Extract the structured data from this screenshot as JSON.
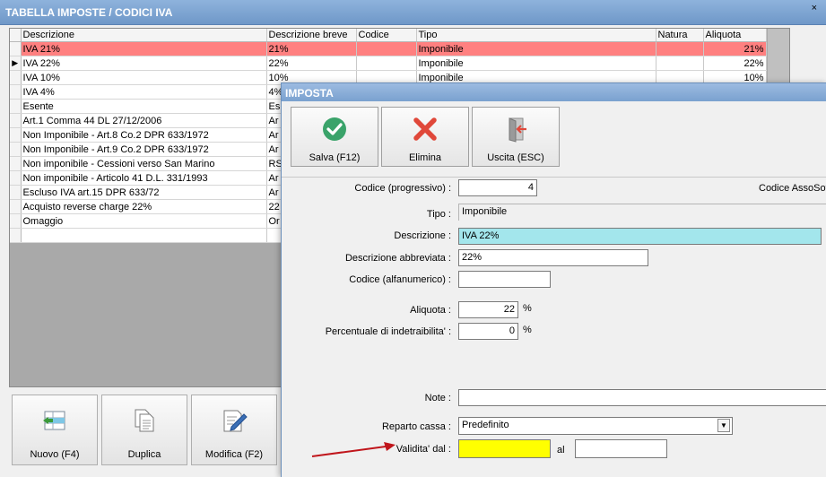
{
  "main_window": {
    "title": "TABELLA IMPOSTE / CODICI IVA",
    "close_glyph": "×",
    "table": {
      "columns": [
        "Descrizione",
        "Descrizione breve",
        "Codice",
        "Tipo",
        "Natura",
        "Aliquota"
      ],
      "rows": [
        {
          "descrizione": "IVA 21%",
          "breve": "21%",
          "codice": "",
          "tipo": "Imponibile",
          "natura": "",
          "aliquota": "21%"
        },
        {
          "descrizione": "IVA 22%",
          "breve": "22%",
          "codice": "",
          "tipo": "Imponibile",
          "natura": "",
          "aliquota": "22%"
        },
        {
          "descrizione": "IVA 10%",
          "breve": "10%",
          "codice": "",
          "tipo": "Imponibile",
          "natura": "",
          "aliquota": "10%"
        },
        {
          "descrizione": "IVA 4%",
          "breve": "4%"
        },
        {
          "descrizione": "Esente",
          "breve": "Es"
        },
        {
          "descrizione": "Art.1 Comma 44 DL 27/12/2006",
          "breve": "Ar"
        },
        {
          "descrizione": "Non Imponibile - Art.8 Co.2 DPR 633/1972",
          "breve": "Ar"
        },
        {
          "descrizione": "Non Imponibile - Art.9 Co.2 DPR 633/1972",
          "breve": "Ar"
        },
        {
          "descrizione": "Non imponibile - Cessioni verso San Marino",
          "breve": "RS"
        },
        {
          "descrizione": "Non imponibile - Articolo 41 D.L. 331/1993",
          "breve": "Ar"
        },
        {
          "descrizione": "Escluso IVA art.15 DPR 633/72",
          "breve": "Ar"
        },
        {
          "descrizione": "Acquisto reverse charge 22%",
          "breve": "22"
        },
        {
          "descrizione": "Omaggio",
          "breve": "Or"
        }
      ],
      "current_row_marker": "▶"
    },
    "buttons": {
      "nuovo": "Nuovo (F4)",
      "duplica": "Duplica",
      "modifica": "Modifica (F2)"
    }
  },
  "dialog": {
    "title": "IMPOSTA",
    "toolbar": {
      "salva": "Salva (F12)",
      "elimina": "Elimina",
      "uscita": "Uscita (ESC)"
    },
    "form": {
      "codice_label": "Codice (progressivo) :",
      "codice_value": "4",
      "codice_assosoft_label": "Codice AssoSof",
      "tipo_label": "Tipo :",
      "tipo_value": "Imponibile",
      "descrizione_label": "Descrizione :",
      "descrizione_value": "IVA 22%",
      "descr_abbr_label": "Descrizione abbreviata :",
      "descr_abbr_value": "22%",
      "codice_alfa_label": "Codice (alfanumerico) :",
      "codice_alfa_value": "",
      "aliquota_label": "Aliquota :",
      "aliquota_value": "22",
      "percent_sign": "%",
      "indetraibilita_label": "Percentuale di indetraibilita' :",
      "indetraibilita_value": "0",
      "note_label": "Note :",
      "note_value": "",
      "reparto_label": "Reparto cassa :",
      "reparto_value": "Predefinito",
      "validita_label": "Validita' dal :",
      "validita_dal_value": "",
      "al_label": "al",
      "validita_al_value": ""
    }
  },
  "colors": {
    "selected_row": "#ff8080",
    "description_field": "#a3e6ec",
    "validity_field": "#ffff00",
    "annotation_arrow": "#c0151b"
  }
}
